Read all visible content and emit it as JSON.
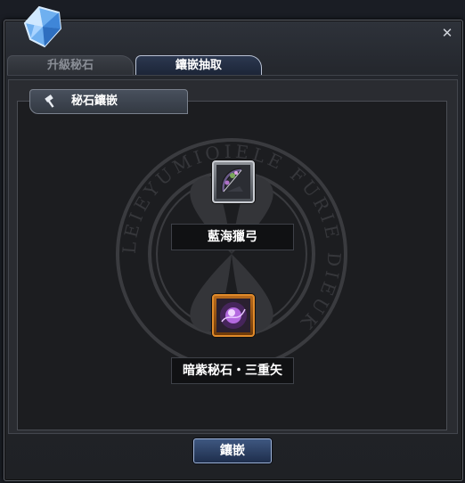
{
  "tabs": [
    {
      "label": "升級秘石",
      "active": false
    },
    {
      "label": "鑲嵌抽取",
      "active": true
    }
  ],
  "section": {
    "title": "秘石鑲嵌",
    "icon": "hammer-icon"
  },
  "emblem_text": "LEIEYUMIOIELE FURIE DIEUK",
  "weapon_slot": {
    "name": "藍海獵弓",
    "icon": "bow-icon"
  },
  "gem_slot": {
    "name": "暗紫秘石・三重矢",
    "icon": "purple-gem-icon"
  },
  "actions": {
    "embed_label": "鑲嵌"
  },
  "colors": {
    "accent": "#9fb4d8",
    "gem_border": "#e08a2a",
    "background": "#1c1d20"
  }
}
